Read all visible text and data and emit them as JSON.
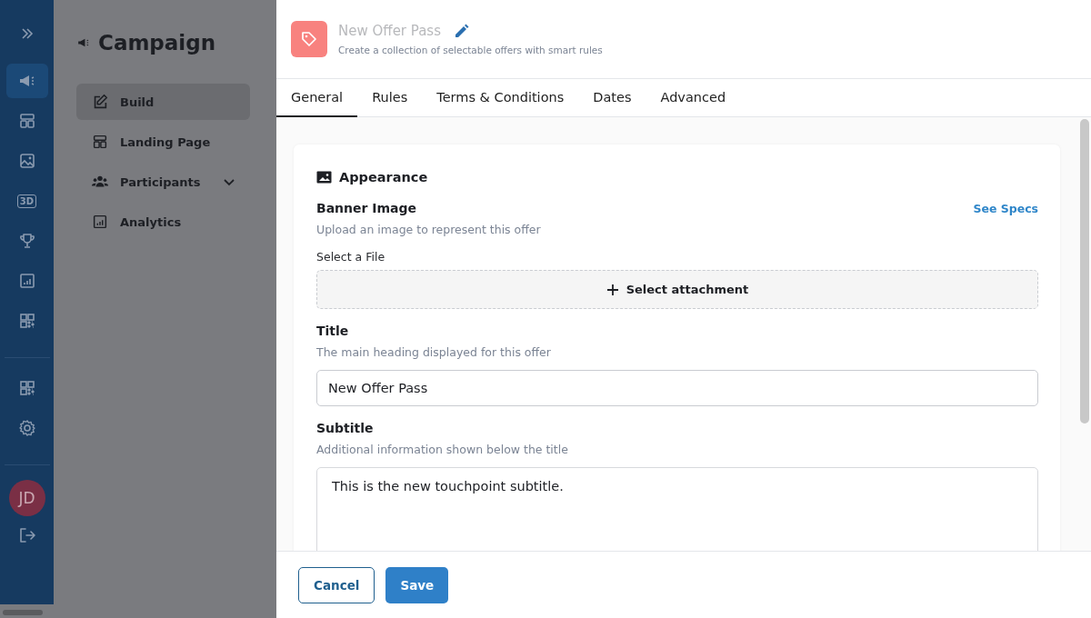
{
  "rail": {
    "items": [
      {
        "kind": "megaphone",
        "selected": true
      },
      {
        "kind": "layout",
        "selected": false
      },
      {
        "kind": "image",
        "selected": false
      },
      {
        "kind": "text",
        "text": "3D",
        "selected": false
      },
      {
        "kind": "trophy",
        "selected": false
      },
      {
        "kind": "chart",
        "selected": false
      },
      {
        "kind": "qr",
        "selected": false
      }
    ],
    "bottom_items": [
      {
        "kind": "qr"
      },
      {
        "kind": "gear"
      }
    ],
    "avatar": "JD"
  },
  "nav": {
    "title": "Campaign",
    "items": [
      {
        "label": "Build",
        "kind": "edit",
        "selected": true,
        "expandable": false
      },
      {
        "label": "Landing Page",
        "kind": "layout",
        "selected": false,
        "expandable": false
      },
      {
        "label": "Participants",
        "kind": "users",
        "selected": false,
        "expandable": true
      },
      {
        "label": "Analytics",
        "kind": "chart",
        "selected": false,
        "expandable": false
      }
    ]
  },
  "drawer": {
    "title": "New Offer Pass",
    "subtitle": "Create a collection of selectable offers with smart rules",
    "tabs": [
      {
        "label": "General",
        "selected": true
      },
      {
        "label": "Rules",
        "selected": false
      },
      {
        "label": "Terms & Conditions",
        "selected": false
      },
      {
        "label": "Dates",
        "selected": false
      },
      {
        "label": "Advanced",
        "selected": false
      }
    ],
    "section": {
      "title": "Appearance",
      "banner": {
        "label": "Banner Image",
        "link": "See Specs",
        "hint": "Upload an image to represent this offer",
        "file_label": "Select a File",
        "button": "Select attachment"
      },
      "title_field": {
        "label": "Title",
        "hint": "The main heading displayed for this offer",
        "value": "New Offer Pass"
      },
      "subtitle_field": {
        "label": "Subtitle",
        "hint": "Additional information shown below the title",
        "value": "This is the new touchpoint subtitle."
      }
    },
    "buttons": {
      "cancel": "Cancel",
      "save": "Save"
    }
  }
}
